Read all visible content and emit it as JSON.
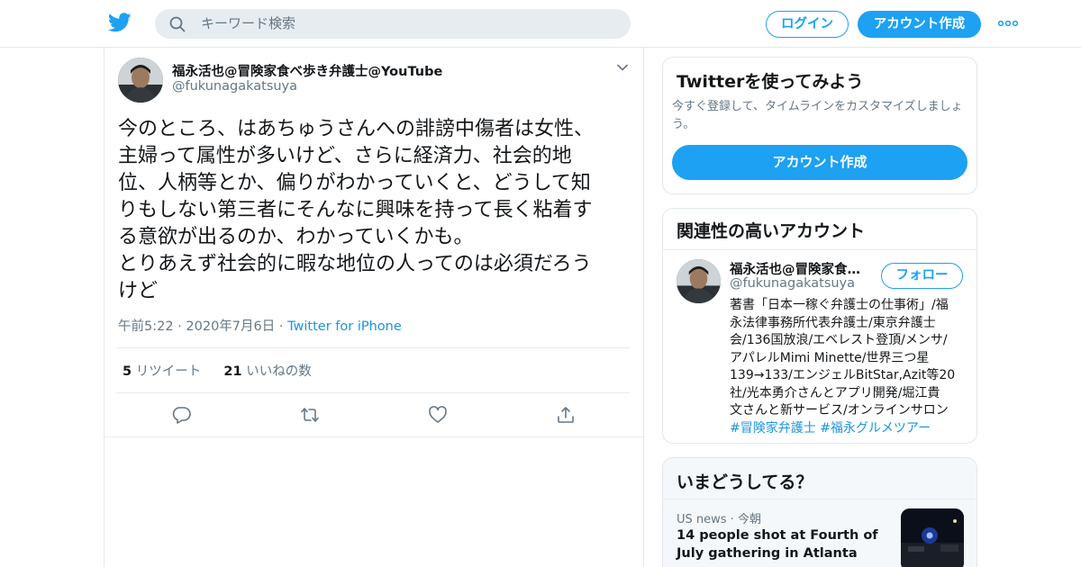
{
  "header": {
    "search_placeholder": "キーワード検索",
    "login_label": "ログイン",
    "signup_label": "アカウント作成"
  },
  "tweet": {
    "author_name": "福永活也@冒険家食べ歩き弁護士@YouTube",
    "author_handle": "@fukunagakatsuya",
    "text_lines": [
      "今のところ、はあちゅうさんへの誹謗中傷者は女性、",
      "主婦って属性が多いけど、さらに経済力、社会的地",
      "位、人柄等とか、偏りがわかっていくと、どうして知",
      "りもしない第三者にそんなに興味を持って長く粘着す",
      "る意欲が出るのか、わかっていくかも。",
      "とりあえず社会的に暇な地位の人ってのは必須だろう",
      "けど"
    ],
    "time": "午前5:22",
    "date": "2020年7月6日",
    "source": "Twitter for iPhone",
    "retweets_count": "5",
    "retweets_label": "リツイート",
    "likes_count": "21",
    "likes_label": "いいねの数"
  },
  "signup_card": {
    "title": "Twitterを使ってみよう",
    "description": "今すぐ登録して、タイムラインをカスタマイズしましょう。",
    "button_label": "アカウント作成"
  },
  "related_card": {
    "title": "関連性の高いアカウント",
    "name": "福永活也@冒険家食…",
    "handle": "@fukunagakatsuya",
    "follow_label": "フォロー",
    "bio_lines": [
      "著書「日本一稼ぐ弁護士の仕事術」/福",
      "永法律事務所代表弁護士/東京弁護士",
      "会/136国放浪/エベレスト登頂/メンサ/",
      "アパレルMimi Minette/世界三つ星",
      "139→133/エンジェルBitStar,Azit等20",
      "社/光本勇介さんとアプリ開発/堀江貴",
      "文さんと新サービス/オンラインサロン"
    ],
    "hashtags": [
      "#冒険家弁護士",
      "#福永グルメツアー"
    ]
  },
  "trends_card": {
    "title": "いまどうしてる？",
    "trend_category": "US news",
    "trend_time": "今朝",
    "trend_title": "14 people shot at Fourth of July gathering in Atlanta"
  },
  "colors": {
    "accent": "#1da1f2",
    "link": "#1b95e0",
    "text_primary": "#14171a",
    "text_secondary": "#657786"
  },
  "icons": [
    "twitter-bird-icon",
    "search-icon",
    "more-dots-icon",
    "chevron-down-icon",
    "reply-icon",
    "retweet-icon",
    "like-icon",
    "share-icon"
  ]
}
